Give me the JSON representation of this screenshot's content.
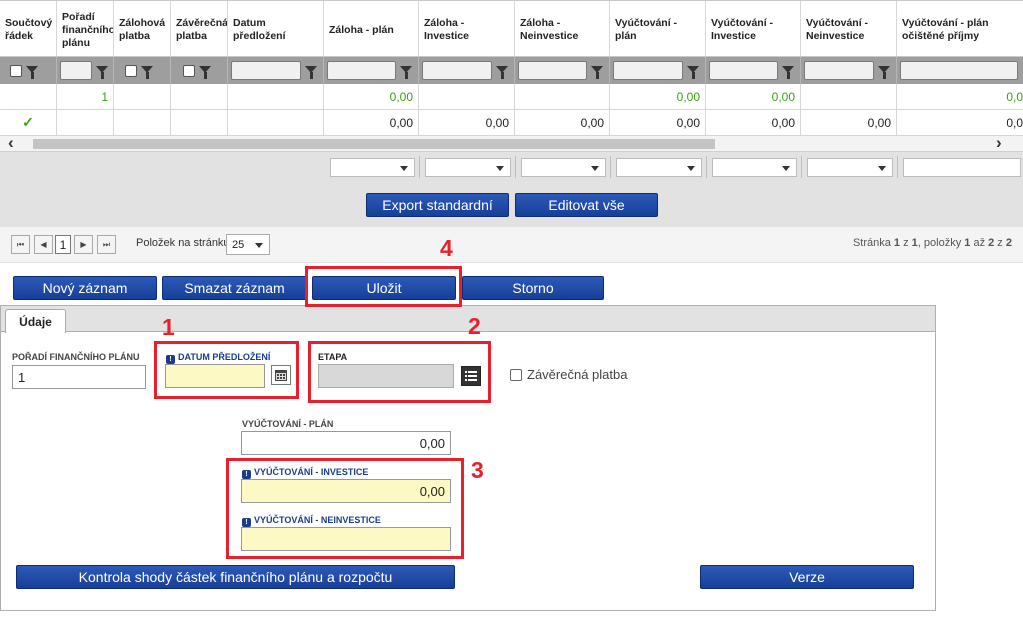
{
  "grid": {
    "columns": [
      "Součtový řádek",
      "Pořadí finančního plánu",
      "Zálohová platba",
      "Závěrečná platba",
      "Datum předložení",
      "Záloha - plán",
      "Záloha - Investice",
      "Záloha - Neinvestice",
      "Vyúčtování - plán",
      "Vyúčtování - Investice",
      "Vyúčtování - Neinvestice",
      "Vyúčtování - plán očištěné příjmy"
    ],
    "row1": [
      "",
      "1",
      "",
      "",
      "",
      "0,00",
      "",
      "",
      "0,00",
      "0,00",
      "",
      "0,0"
    ],
    "row2": [
      "✓",
      "",
      "",
      "",
      "",
      "0,00",
      "0,00",
      "0,00",
      "0,00",
      "0,00",
      "0,00",
      "0,0"
    ]
  },
  "scroll": {
    "left_arrow": "‹",
    "right_arrow": "›"
  },
  "toolbar": {
    "export_label": "Export standardní",
    "edit_all_label": "Editovat vše"
  },
  "pager": {
    "first": "⏮",
    "prev": "◀",
    "page": "1",
    "next": "▶",
    "last": "⏭",
    "per_page_label": "Položek na stránku",
    "per_page_value": "25",
    "info_prefix": "Stránka ",
    "info_page": "1",
    "info_mid1": " z ",
    "info_pages": "1",
    "info_mid2": ", položky ",
    "info_from": "1",
    "info_mid3": " až ",
    "info_to": "2",
    "info_mid4": " z ",
    "info_total": "2"
  },
  "actions": {
    "new_label": "Nový záznam",
    "delete_label": "Smazat záznam",
    "save_label": "Uložit",
    "cancel_label": "Storno"
  },
  "annotations": {
    "a1": "1",
    "a2": "2",
    "a3": "3",
    "a4": "4"
  },
  "tab": {
    "label": "Údaje"
  },
  "form": {
    "poradi_label": "POŘADÍ FINANČNÍHO PLÁNU",
    "poradi_value": "1",
    "datum_label": "DATUM PŘEDLOŽENÍ",
    "datum_value": "",
    "etapa_label": "ETAPA",
    "etapa_value": "",
    "zaverecna_label": "Závěrečná platba",
    "vyuct_plan_label": "VYÚČTOVÁNÍ - PLÁN",
    "vyuct_plan_value": "0,00",
    "vyuct_inv_label": "VYÚČTOVÁNÍ - INVESTICE",
    "vyuct_inv_value": "0,00",
    "vyuct_neinv_label": "VYÚČTOVÁNÍ - NEINVESTICE",
    "vyuct_neinv_value": "",
    "required_mark": "!",
    "kontrola_label": "Kontrola shody částek finančního plánu a rozpočtu",
    "verze_label": "Verze"
  },
  "colors": {
    "accent": "#1b3d8c",
    "annotation": "#e8202b",
    "required_bg": "#fcf9c4",
    "positive": "#3aa014"
  }
}
